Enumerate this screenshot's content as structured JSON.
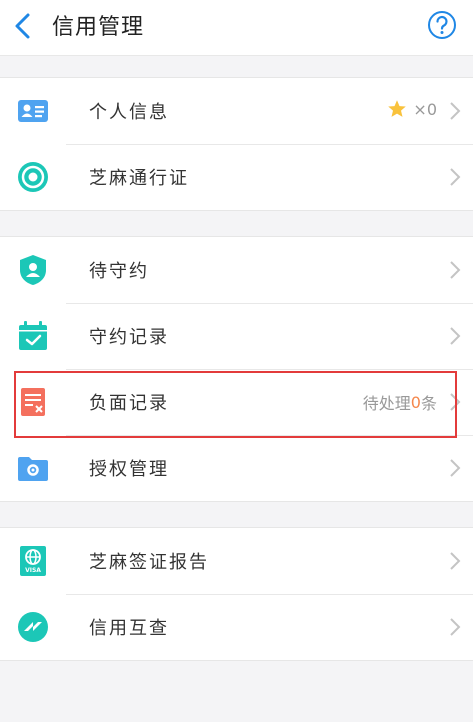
{
  "header": {
    "title": "信用管理"
  },
  "groups": [
    {
      "items": [
        {
          "label": "个人信息",
          "extra_prefix": "×",
          "extra_value": "0"
        },
        {
          "label": "芝麻通行证"
        }
      ]
    },
    {
      "items": [
        {
          "label": "待守约"
        },
        {
          "label": "守约记录"
        },
        {
          "label": "负面记录",
          "extra_prefix": "待处理",
          "extra_value": "0",
          "extra_suffix": "条"
        },
        {
          "label": "授权管理"
        }
      ]
    },
    {
      "items": [
        {
          "label": "芝麻签证报告"
        },
        {
          "label": "信用互查"
        }
      ]
    }
  ],
  "icons": {
    "visa_text": "VISA"
  },
  "colors": {
    "accent_blue": "#1f87e5",
    "icon_teal": "#1cc7b7",
    "icon_red": "#f4705e",
    "star": "#f9c23c",
    "highlight": "#f5874c",
    "frame_red": "#e33b3b"
  }
}
